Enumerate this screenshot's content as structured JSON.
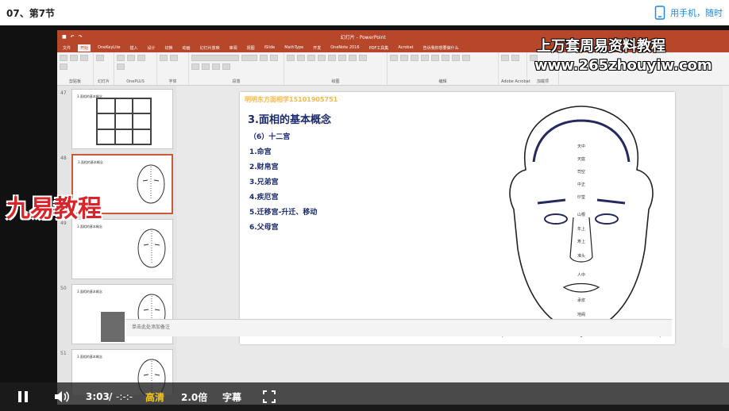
{
  "header": {
    "video_title": "07、第7节",
    "phone_text": "用手机，随时"
  },
  "ppt": {
    "app_title": "幻灯片 - PowerPoint",
    "tabs": [
      "文件",
      "开始",
      "OneKeyLite",
      "插入",
      "设计",
      "切换",
      "动画",
      "幻灯片放映",
      "审阅",
      "视图",
      "iSlide",
      "MathType",
      "开发",
      "OneNote 2016",
      "PDF工具集",
      "Acrobat",
      "告诉我你想要做什么"
    ],
    "active_tab": "开始",
    "ribbon_groups": [
      "剪贴板",
      "幻灯片",
      "OnePLUS",
      "字体",
      "段落",
      "绘图",
      "编辑",
      "Adobe Acrobat",
      "加载项"
    ],
    "thumbnails": [
      {
        "number": "47",
        "title": "3.面相的基本概念"
      },
      {
        "number": "48",
        "title": "3.面相的基本概念"
      },
      {
        "number": "49",
        "title": "3.面相的基本概念"
      },
      {
        "number": "50",
        "title": "3.面相的基本概念"
      },
      {
        "number": "51",
        "title": "3.面相的基本概念"
      }
    ],
    "notes_placeholder": "单击此处添加备注"
  },
  "slide": {
    "phone_line": "明明东方面相学15101905751",
    "title": "3.面相的基本概念",
    "subtitle": "（6）十二宫",
    "items": [
      "1.命宫",
      "2.财帛宫",
      "3.兄弟宫",
      "4.疾厄宫",
      "5.迁移宫-升迁、移动",
      "6.父母宫"
    ],
    "face_labels": [
      "天中",
      "天庭",
      "司空",
      "中正",
      "印堂",
      "山根",
      "年上",
      "寿上",
      "准头",
      "人中",
      "承浆",
      "地阁"
    ]
  },
  "watermarks": {
    "line1": "上万套周易资料教程",
    "line2": "www.265zhouyiw.com",
    "line3": "九易教程"
  },
  "player": {
    "current_time": "3:03",
    "separator": "/",
    "duration": "-:-:-",
    "quality": "高清",
    "speed": "2.0倍",
    "subtitle_btn": "字幕",
    "accent_color": "#f5c518"
  }
}
